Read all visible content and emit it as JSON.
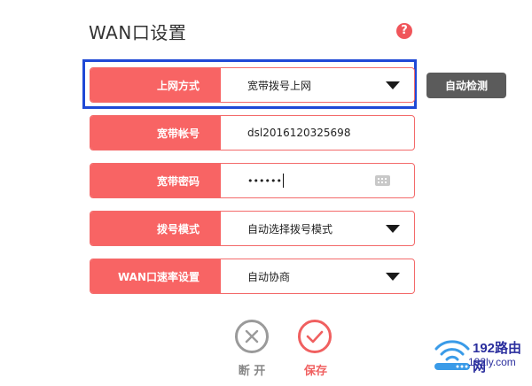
{
  "header": {
    "title": "WAN口设置",
    "help_symbol": "?"
  },
  "form": {
    "fields": [
      {
        "label": "上网方式",
        "value": "宽带拨号上网",
        "control": "dropdown"
      },
      {
        "label": "宽带帐号",
        "value": "dsl2016120325698",
        "control": "text"
      },
      {
        "label": "宽带密码",
        "value": "••••••",
        "control": "password"
      },
      {
        "label": "拨号模式",
        "value": "自动选择拨号模式",
        "control": "dropdown"
      },
      {
        "label": "WAN口速率设置",
        "value": "自动协商",
        "control": "dropdown"
      }
    ],
    "auto_detect_label": "自动检测"
  },
  "actions": {
    "disconnect_label": "断 开",
    "save_label": "保存"
  },
  "watermark": {
    "name": "192路由网",
    "url": "192ly.com"
  },
  "colors": {
    "accent": "#f86464",
    "highlight": "#1f49d6",
    "dark_button": "#5b5b5b",
    "help": "#f0555a"
  },
  "icons": [
    "help-icon",
    "chevron-down-icon",
    "keyboard-icon",
    "close-circle-icon",
    "check-circle-icon",
    "wifi-logo-icon"
  ]
}
